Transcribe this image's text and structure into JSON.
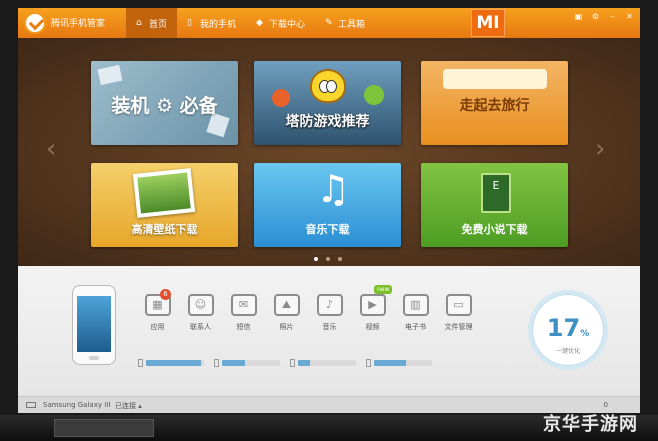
{
  "app": {
    "title": "腾讯手机管家"
  },
  "nav": [
    {
      "label": "首页",
      "icon": "home-icon",
      "active": true
    },
    {
      "label": "我的手机",
      "icon": "phone-icon",
      "active": false
    },
    {
      "label": "下载中心",
      "icon": "download-icon",
      "active": false
    },
    {
      "label": "工具箱",
      "icon": "wrench-icon",
      "active": false
    }
  ],
  "brand": {
    "logo_text": "MI"
  },
  "banner": {
    "tiles": [
      {
        "label": "装机 ⚙ 必备"
      },
      {
        "label": "塔防游戏推荐"
      },
      {
        "label": "走起去旅行"
      },
      {
        "label": "高清壁纸下载"
      },
      {
        "label": "音乐下载"
      },
      {
        "label": "免费小说下载"
      }
    ],
    "page_count": 3,
    "active_page": 1
  },
  "apps": [
    {
      "label": "应用",
      "icon": "apps-icon",
      "badge": "6"
    },
    {
      "label": "联系人",
      "icon": "contacts-icon"
    },
    {
      "label": "短信",
      "icon": "sms-icon"
    },
    {
      "label": "照片",
      "icon": "photos-icon"
    },
    {
      "label": "音乐",
      "icon": "music-icon"
    },
    {
      "label": "视频",
      "icon": "video-icon",
      "tag": "new"
    },
    {
      "label": "电子书",
      "icon": "ebook-icon"
    },
    {
      "label": "文件管理",
      "icon": "file-manager-icon"
    }
  ],
  "storage": [
    0.95,
    0.4,
    0.2,
    0.55
  ],
  "optimizer": {
    "value": "17",
    "unit": "%",
    "label": "一键优化"
  },
  "status": {
    "device": "Samsung Galaxy III",
    "connection": "已连接 ▴",
    "right": "0"
  },
  "watermark": "京华手游网",
  "colors": {
    "titlebar": "#f39a1c",
    "accent_blue": "#3e8fc4"
  }
}
